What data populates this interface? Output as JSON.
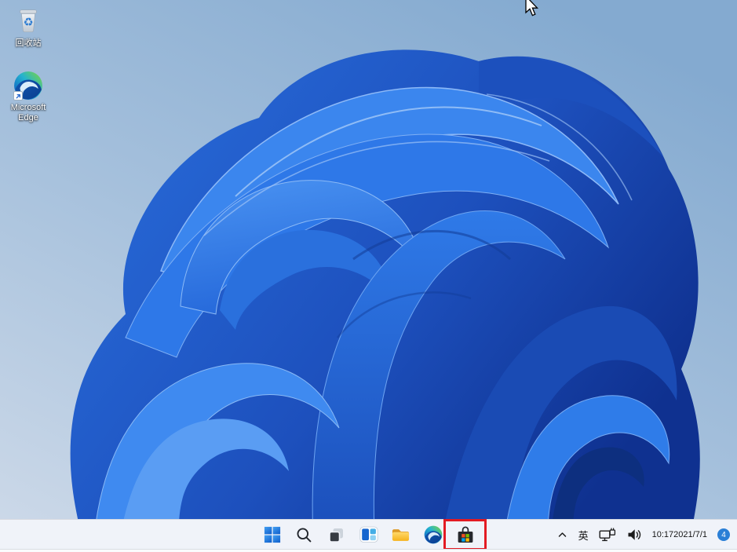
{
  "desktop": {
    "icons": [
      {
        "id": "recycle-bin",
        "label": "回收站"
      },
      {
        "id": "microsoft-edge",
        "label": "Microsoft Edge"
      }
    ]
  },
  "taskbar": {
    "icons": [
      {
        "id": "start"
      },
      {
        "id": "search"
      },
      {
        "id": "task-view"
      },
      {
        "id": "widgets"
      },
      {
        "id": "file-explorer"
      },
      {
        "id": "edge"
      },
      {
        "id": "store",
        "highlighted": true
      }
    ],
    "highlight_color": "#e31b23",
    "tray": {
      "ime_label": "英",
      "time": "10:17",
      "date": "2021/7/1",
      "badge_count": "4"
    }
  },
  "colors": {
    "taskbar_bg": "#f0f3f9",
    "badge_bg": "#2a7fd6",
    "bloom_blue": "#2e78e8",
    "background_top": "#8ab0d3",
    "background_bottom": "#cbd8e8"
  }
}
